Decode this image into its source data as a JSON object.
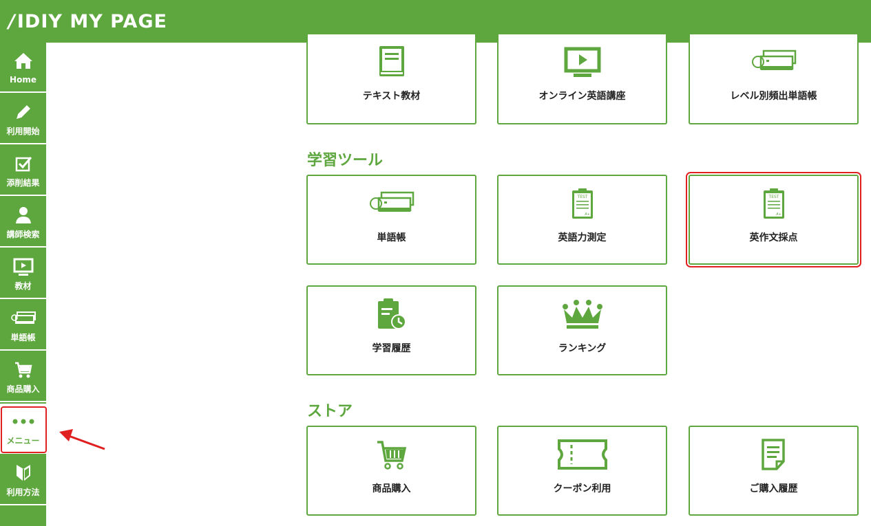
{
  "header": {
    "logo_text": "IDIY MY PAGE"
  },
  "colors": {
    "brand": "#5ea63e",
    "highlight": "#e02020"
  },
  "sidebar": {
    "items": [
      {
        "label": "Home",
        "icon": "home-icon"
      },
      {
        "label": "利用開始",
        "icon": "pencil-icon"
      },
      {
        "label": "添削結果",
        "icon": "checkbox-icon"
      },
      {
        "label": "講師検索",
        "icon": "user-icon"
      },
      {
        "label": "教材",
        "icon": "monitor-icon"
      },
      {
        "label": "単語帳",
        "icon": "flashcards-icon"
      },
      {
        "label": "商品購入",
        "icon": "cart-icon"
      },
      {
        "label": "メニュー",
        "icon": "dots-icon"
      },
      {
        "label": "利用方法",
        "icon": "beginner-mark-icon"
      }
    ]
  },
  "sections": {
    "tools": {
      "title": "学習ツール"
    },
    "store": {
      "title": "ストア"
    }
  },
  "cards": {
    "text_material": "テキスト教材",
    "online_course": "オンライン英語講座",
    "level_vocab": "レベル別頻出単語帳",
    "vocab": "単語帳",
    "eng_test": "英語力測定",
    "essay_scoring": "英作文採点",
    "history": "学習履歴",
    "ranking": "ランキング",
    "purchase": "商品購入",
    "coupon": "クーポン利用",
    "purchase_history": "ご購入履歴"
  },
  "icons": {
    "test_label": "TEST",
    "grade_label": "A+"
  }
}
